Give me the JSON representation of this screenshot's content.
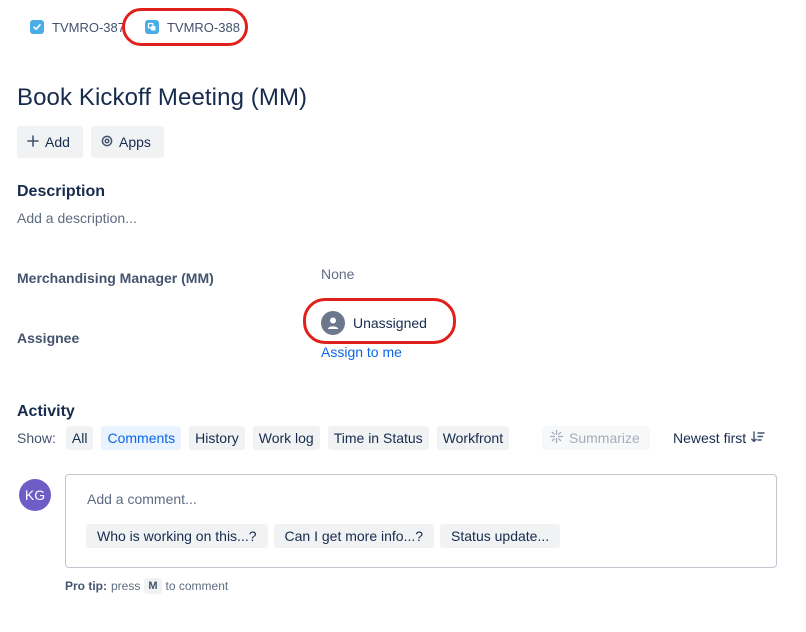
{
  "breadcrumb": {
    "parent": {
      "key": "TVMRO-387",
      "icon": "checkbox-task-icon"
    },
    "current": {
      "key": "TVMRO-388",
      "icon": "subtask-icon"
    }
  },
  "issue": {
    "title": "Book Kickoff Meeting (MM)"
  },
  "actions": {
    "add_label": "Add",
    "apps_label": "Apps"
  },
  "description": {
    "heading": "Description",
    "placeholder": "Add a description..."
  },
  "fields": {
    "merchandising_manager": {
      "label": "Merchandising Manager (MM)",
      "value": "None"
    },
    "assignee": {
      "label": "Assignee",
      "value": "Unassigned",
      "assign_link": "Assign to me"
    }
  },
  "activity": {
    "heading": "Activity",
    "show_label": "Show:",
    "filters": [
      "All",
      "Comments",
      "History",
      "Work log",
      "Time in Status",
      "Workfront"
    ],
    "active_filter": "Comments",
    "summarize_label": "Summarize",
    "sort_label": "Newest first"
  },
  "comment": {
    "avatar_initials": "KG",
    "placeholder": "Add a comment...",
    "suggestions": [
      "Who is working on this...?",
      "Can I get more info...?",
      "Status update..."
    ],
    "protip_prefix": "Pro tip:",
    "protip_press": "press",
    "protip_key": "M",
    "protip_suffix": "to comment"
  },
  "colors": {
    "accent": "#0c66e4",
    "annotation": "#e0201b",
    "avatar": "#6e5dc6",
    "active_filter_bg": "#e9f2ff"
  }
}
